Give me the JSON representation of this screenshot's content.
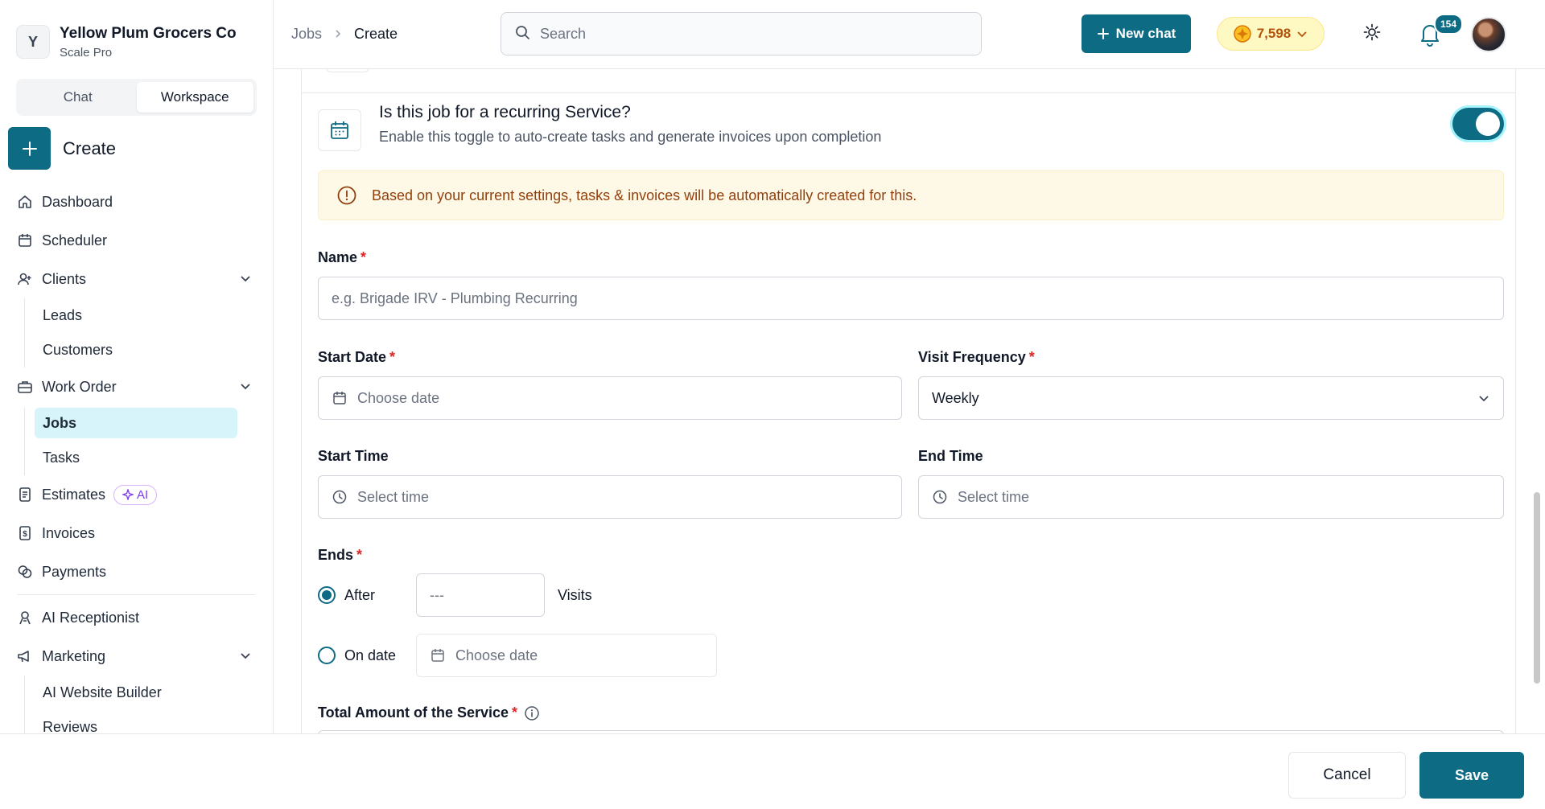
{
  "org": {
    "initial": "Y",
    "name": "Yellow Plum Grocers Co",
    "plan": "Scale Pro"
  },
  "segment": {
    "chat": "Chat",
    "workspace": "Workspace"
  },
  "create_label": "Create",
  "nav": {
    "dashboard": "Dashboard",
    "scheduler": "Scheduler",
    "clients": "Clients",
    "leads": "Leads",
    "customers": "Customers",
    "work_order": "Work Order",
    "jobs": "Jobs",
    "tasks": "Tasks",
    "estimates": "Estimates",
    "ai_badge": "AI",
    "invoices": "Invoices",
    "payments": "Payments",
    "ai_receptionist": "AI Receptionist",
    "marketing": "Marketing",
    "ai_website_builder": "AI Website Builder",
    "reviews": "Reviews"
  },
  "breadcrumb": {
    "parent": "Jobs",
    "current": "Create"
  },
  "search": {
    "placeholder": "Search"
  },
  "header": {
    "new_chat": "New chat",
    "credits": "7,598",
    "notifications": "154"
  },
  "recurring": {
    "title": "Is this job for a recurring Service?",
    "subtitle": "Enable this toggle to auto-create tasks and generate invoices upon completion",
    "enabled": true
  },
  "alert": "Based on your current settings, tasks & invoices will be automatically created for this.",
  "form": {
    "name_label": "Name",
    "name_placeholder": "e.g. Brigade IRV - Plumbing Recurring",
    "start_date_label": "Start Date",
    "start_date_placeholder": "Choose date",
    "visit_frequency_label": "Visit Frequency",
    "visit_frequency_value": "Weekly",
    "start_time_label": "Start Time",
    "start_time_placeholder": "Select time",
    "end_time_label": "End Time",
    "end_time_placeholder": "Select time",
    "ends_label": "Ends",
    "after_label": "After",
    "visits_placeholder": "---",
    "visits_label": "Visits",
    "on_date_label": "On date",
    "on_date_placeholder": "Choose date",
    "total_amount_label": "Total Amount of the Service",
    "required_mark": "*"
  },
  "footer": {
    "cancel": "Cancel",
    "save": "Save"
  },
  "colors": {
    "accent": "#0e6b84",
    "active_nav": "#d6f4fa",
    "alert_bg": "#fef9e7",
    "required": "#dc2626"
  }
}
